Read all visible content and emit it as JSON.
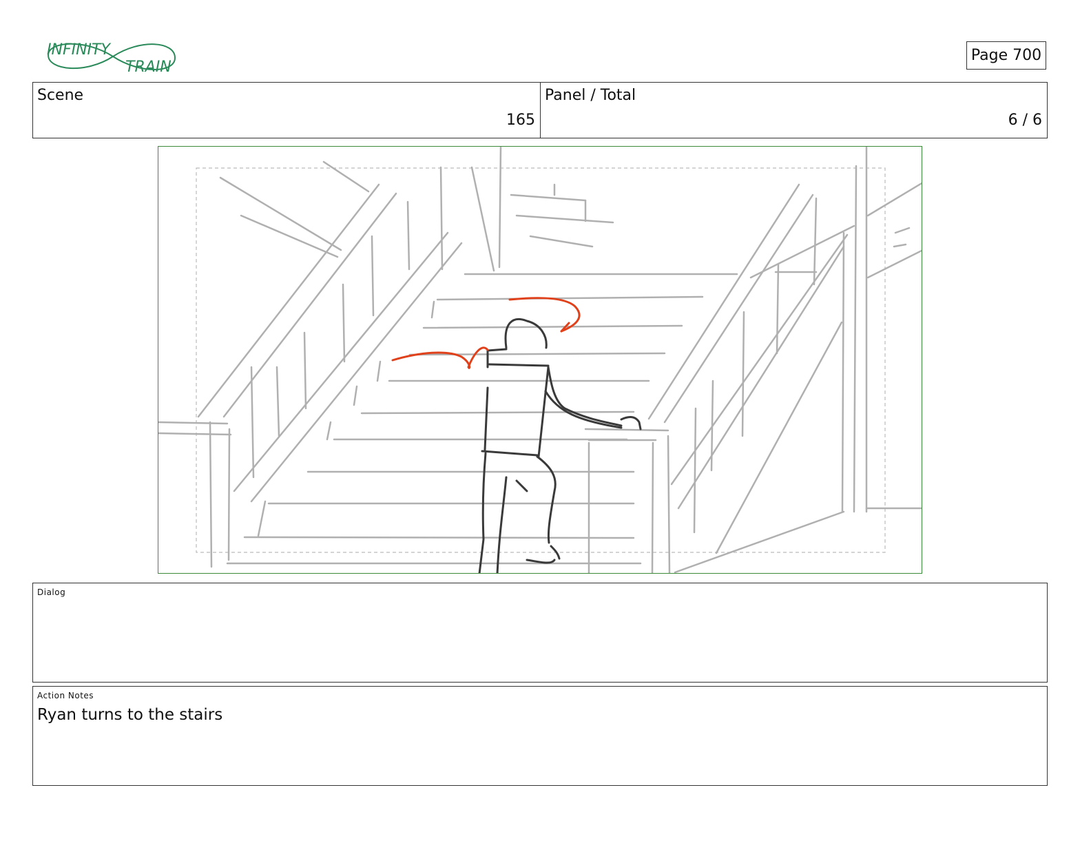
{
  "logo": {
    "line1": "INFINITY",
    "line2": "TRAIN",
    "color": "#2a8a5a"
  },
  "page": {
    "label": "Page 700"
  },
  "header": {
    "scene_label": "Scene",
    "scene_value": "165",
    "panel_label": "Panel / Total",
    "panel_value": "6 / 6"
  },
  "panel_frame": {
    "border_color": "#3a8a3a",
    "sketch_color": "#b0b0b0",
    "figure_color": "#3a3a3a",
    "motion_color": "#e0401a"
  },
  "dialog": {
    "label": "Dialog",
    "text": ""
  },
  "action_notes": {
    "label": "Action Notes",
    "text": "Ryan turns to the stairs"
  }
}
